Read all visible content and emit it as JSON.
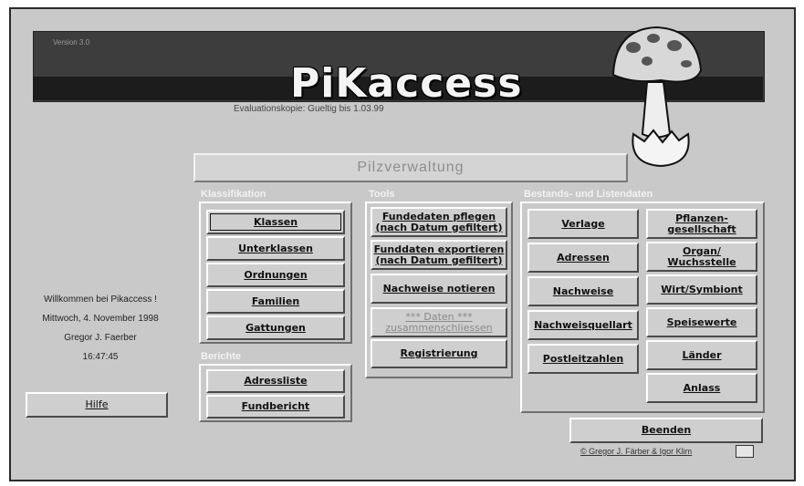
{
  "app": {
    "version": "Version 3.0",
    "logo": "PiKaccess",
    "eval_notice": "Evaluationskopie: Gueltig bis 1.03.99",
    "section_title": "Pilzverwaltung"
  },
  "groups": {
    "klassifikation": "Klassifikation",
    "berichte": "Berichte",
    "tools": "Tools",
    "bestand": "Bestands- und Listendaten"
  },
  "klassifikation_buttons": [
    "Klassen",
    "Unterklassen",
    "Ordnungen",
    "Familien",
    "Gattungen"
  ],
  "berichte_buttons": [
    "Adressliste",
    "Fundbericht"
  ],
  "tools_buttons": [
    "Fundedaten pflegen\n(nach Datum gefiltert)",
    "Funddaten exportieren\n(nach Datum gefiltert)",
    "Nachweise notieren",
    "*** Daten ***\nzusammenschliessen",
    "Registrierung"
  ],
  "bestand_left": [
    "Verlage",
    "Adressen",
    "Nachweise",
    "Nachweisquellart",
    "Postleitzahlen"
  ],
  "bestand_right": [
    "Pflanzen-\ngesellschaft",
    "Organ/\nWuchsstelle",
    "Wirt/Symbiont",
    "Speisewerte",
    "Länder",
    "Anlass"
  ],
  "welcome": {
    "line1": "Willkommen bei Pikaccess !",
    "line2": "Mittwoch, 4. November 1998",
    "line3": "Gregor J. Faerber",
    "line4": "16:47:45"
  },
  "hilfe": "Hilfe",
  "beenden": "Beenden",
  "copyright": "© Gregor J. Färber & Igor Klim",
  "colors": {
    "window_bg": "#c9c9c9",
    "banner": "#3d3d3d",
    "group_label": "#f2f2f2"
  }
}
